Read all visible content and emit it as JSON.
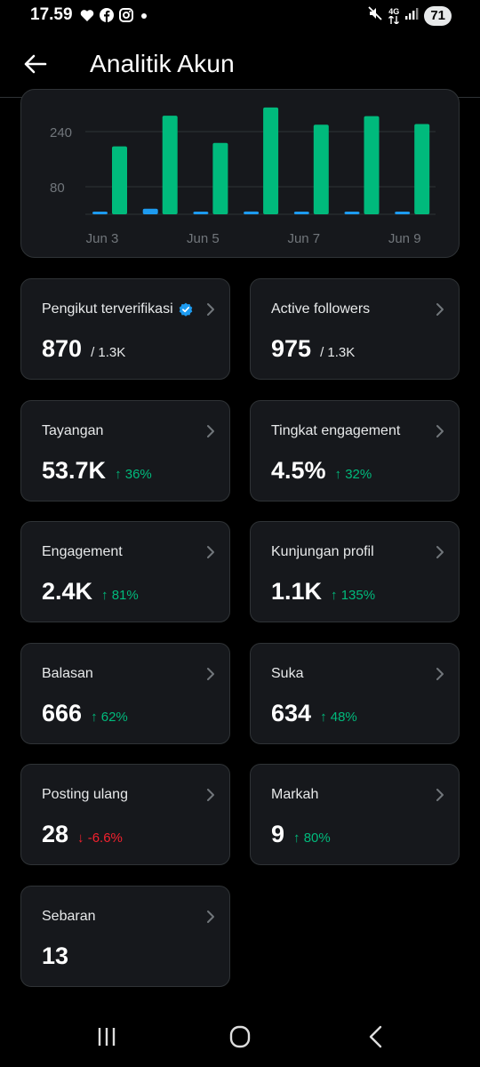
{
  "status_bar": {
    "time": "17.59",
    "network": "4G",
    "battery": "71"
  },
  "header": {
    "title": "Analitik Akun"
  },
  "chart_data": {
    "type": "bar",
    "categories": [
      "Jun 3",
      "",
      "Jun 5",
      "",
      "Jun 7",
      "",
      "Jun 9"
    ],
    "series": [
      {
        "values": [
          4,
          16,
          4,
          8,
          5,
          4,
          4
        ],
        "color": "#1d9bf0"
      },
      {
        "values": [
          197,
          286,
          207,
          310,
          260,
          285,
          262
        ],
        "color": "#00ba7c"
      }
    ],
    "y_ticks": [
      "240",
      "80"
    ],
    "x_tick_labels": [
      "Jun 3",
      "Jun 5",
      "Jun 7",
      "Jun 9"
    ],
    "grid": true
  },
  "metrics": [
    {
      "label": "Pengikut terverifikasi",
      "value": "870",
      "total": "/ 1.3K",
      "verified": true
    },
    {
      "label": "Active followers",
      "value": "975",
      "total": "/ 1.3K"
    },
    {
      "label": "Tayangan",
      "value": "53.7K",
      "change": "↑ 36%",
      "direction": "up"
    },
    {
      "label": "Tingkat engagement",
      "value": "4.5%",
      "change": "↑ 32%",
      "direction": "up"
    },
    {
      "label": "Engagement",
      "value": "2.4K",
      "change": "↑ 81%",
      "direction": "up"
    },
    {
      "label": "Kunjungan profil",
      "value": "1.1K",
      "change": "↑ 135%",
      "direction": "up"
    },
    {
      "label": "Balasan",
      "value": "666",
      "change": "↑ 62%",
      "direction": "up"
    },
    {
      "label": "Suka",
      "value": "634",
      "change": "↑ 48%",
      "direction": "up"
    },
    {
      "label": "Posting ulang",
      "value": "28",
      "change": "↓ -6.6%",
      "direction": "down"
    },
    {
      "label": "Markah",
      "value": "9",
      "change": "↑ 80%",
      "direction": "up"
    },
    {
      "label": "Sebaran",
      "value": "13"
    }
  ],
  "icons": {
    "back": "arrow-left-icon",
    "chevron": "chevron-right-icon",
    "verified": "verified-badge-icon",
    "nav_recents": "recent-apps-icon",
    "nav_home": "home-icon",
    "nav_back": "back-icon"
  },
  "colors": {
    "background": "#000000",
    "card": "#16181c",
    "up": "#00ba7c",
    "down": "#f4212e",
    "verified": "#1d9bf0"
  }
}
